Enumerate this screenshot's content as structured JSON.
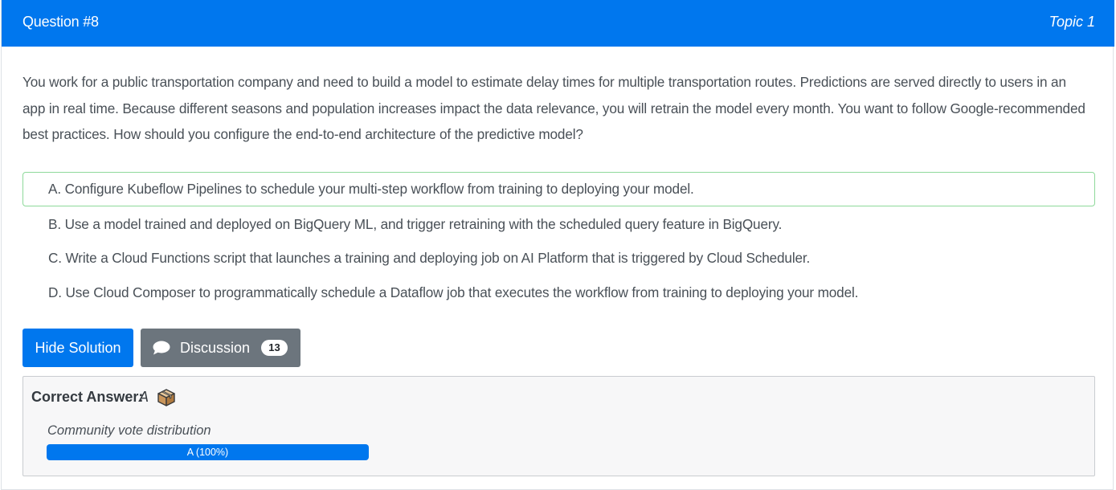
{
  "header": {
    "question_number": "Question #8",
    "topic": "Topic 1",
    "background_color": "#0077ee"
  },
  "question": {
    "text": "You work for a public transportation company and need to build a model to estimate delay times for multiple transportation routes. Predictions are served directly to users in an app in real time. Because different seasons and population increases impact the data relevance, you will retrain the model every month. You want to follow Google-recommended best practices. How should you configure the end-to-end architecture of the predictive model?"
  },
  "choices": [
    {
      "letter": "A.",
      "text": "Configure Kubeflow Pipelines to schedule your multi-step workflow from training to deploying your model.",
      "highlighted": true
    },
    {
      "letter": "B.",
      "text": "Use a model trained and deployed on BigQuery ML, and trigger retraining with the scheduled query feature in BigQuery.",
      "highlighted": false
    },
    {
      "letter": "C.",
      "text": "Write a Cloud Functions script that launches a training and deploying job on AI Platform that is triggered by Cloud Scheduler.",
      "highlighted": false
    },
    {
      "letter": "D.",
      "text": "Use Cloud Composer to programmatically schedule a Dataflow job that executes the workflow from training to deploying your model.",
      "highlighted": false
    }
  ],
  "buttons": {
    "hide_solution": "Hide Solution",
    "discussion": "Discussion",
    "discussion_count": "13",
    "primary_color": "#0077ee",
    "secondary_color": "#6c757d"
  },
  "answer": {
    "label": "Correct Answer:",
    "value": "A",
    "icon": "package-icon",
    "vote_title": "Community vote distribution",
    "vote_label": "A (100%)",
    "vote_fraction": 1.0,
    "correct_border_color": "#8ed99a"
  }
}
